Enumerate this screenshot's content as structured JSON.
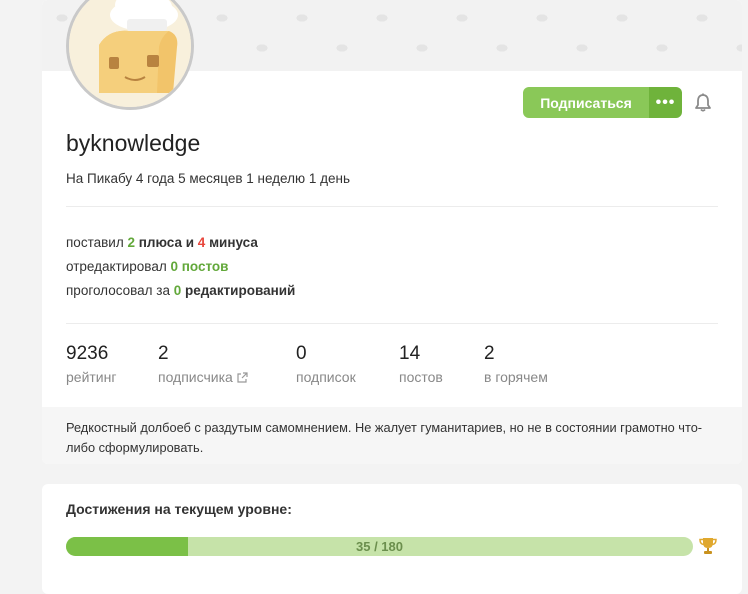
{
  "profile": {
    "username": "byknowledge",
    "member_since": "На Пикабу 4 года 5 месяцев 1 неделю 1 день",
    "subscribe_label": "Подписаться",
    "more_label": "•••",
    "activity": {
      "line1_prefix": "поставил ",
      "pluses_count": "2",
      "pluses_word": " плюса и ",
      "minuses_count": "4",
      "minuses_word": " минуса",
      "line2_prefix": "отредактировал ",
      "edited_count": "0",
      "edited_word": " постов",
      "line3_prefix": "проголосовал за ",
      "voted_count": "0",
      "voted_word": " редактирований"
    },
    "stats": [
      {
        "value": "9236",
        "label": "рейтинг"
      },
      {
        "value": "2",
        "label": "подписчика"
      },
      {
        "value": "0",
        "label": "подписок"
      },
      {
        "value": "14",
        "label": "постов"
      },
      {
        "value": "2",
        "label": "в горячем"
      }
    ],
    "about": "Редкостный долбоеб с раздутым самомнением. Не жалует гуманитариев, но не в состоянии грамотно что-либо сформулировать."
  },
  "achievements": {
    "title": "Достижения на текущем уровне:",
    "progress_text": "35 / 180",
    "progress_current": 35,
    "progress_total": 180
  },
  "colors": {
    "accent_green": "#8ac858",
    "accent_green_dark": "#6fb33b",
    "minus_red": "#e8453b"
  },
  "icons": [
    "bell-icon",
    "external-link-icon",
    "trophy-icon",
    "avatar-image"
  ]
}
